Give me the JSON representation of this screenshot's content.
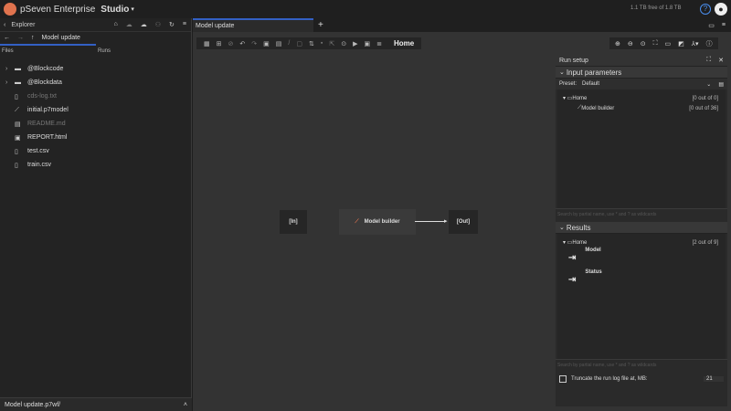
{
  "app": {
    "brand": "pSeven Enterprise",
    "workspace": "Studio",
    "storage": "1.1 TB free of 1.8 TB",
    "help": "?",
    "colors": {
      "accent": "#3360c4",
      "logo": "#e0734e",
      "background": "#333333"
    }
  },
  "explorer": {
    "title": "Explorer",
    "path": "Model update",
    "columns": [
      "Files",
      "Runs"
    ],
    "items": [
      {
        "name": "@Blockcode",
        "type": "folder",
        "dim": false
      },
      {
        "name": "@Blockdata",
        "type": "folder",
        "dim": false
      },
      {
        "name": "cds-log.txt",
        "type": "file",
        "dim": true
      },
      {
        "name": "initial.p7model",
        "type": "model",
        "dim": false
      },
      {
        "name": "README.md",
        "type": "md",
        "dim": true
      },
      {
        "name": "REPORT.html",
        "type": "html",
        "dim": false
      },
      {
        "name": "test.csv",
        "type": "csv",
        "dim": false
      },
      {
        "name": "train.csv",
        "type": "csv",
        "dim": false
      }
    ],
    "footer": "Model update.p7wf/"
  },
  "editor": {
    "tab": "Model update",
    "add_tab": "+",
    "breadcrumb": "Home",
    "nodes": {
      "in": "[In]",
      "block": "Model builder",
      "out": "[Out]"
    }
  },
  "run_setup": {
    "title": "Run setup",
    "inputs": {
      "title": "Input parameters",
      "preset_label": "Preset:",
      "preset_value": "Default",
      "tree": [
        {
          "name": "Home",
          "count": "[0 out of 0]"
        },
        {
          "name": "Model builder",
          "count": "[0 out of 36]"
        }
      ],
      "search_placeholder": "Search by partial name, use * and ? as wildcards"
    },
    "results": {
      "title": "Results",
      "tree": [
        {
          "name": "Home",
          "count": "[2 out of 9]"
        }
      ],
      "items": [
        "Model",
        "Status"
      ],
      "search_placeholder": "Search by partial name, use * and ? as wildcards"
    },
    "truncate_label": "Truncate the run log file at, MB:",
    "truncate_value": "21",
    "truncate_checked": false
  }
}
